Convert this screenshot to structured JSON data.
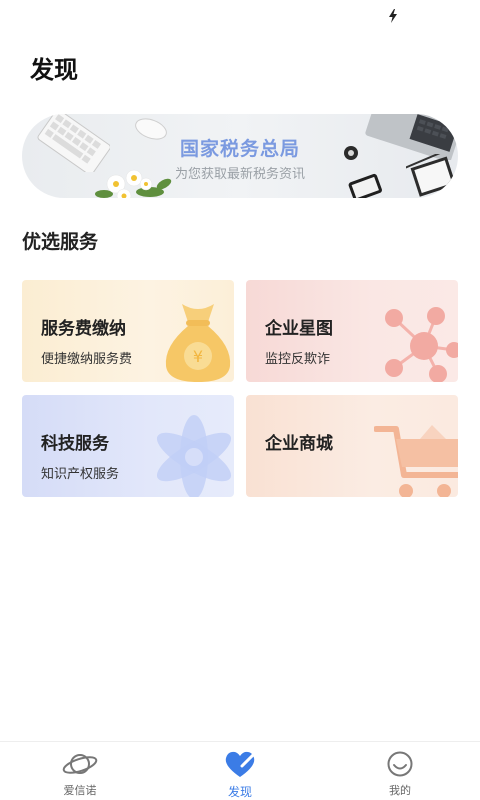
{
  "page": {
    "title": "发现"
  },
  "banner": {
    "title": "国家税务总局",
    "subtitle": "为您获取最新税务资讯"
  },
  "section": {
    "title": "优选服务"
  },
  "services": [
    {
      "title": "服务费缴纳",
      "subtitle": "便捷缴纳服务费",
      "icon": "money-bag-icon",
      "accent": "#f5c86a"
    },
    {
      "title": "企业星图",
      "subtitle": "监控反欺诈",
      "icon": "network-graph-icon",
      "accent": "#f2a6a0"
    },
    {
      "title": "科技服务",
      "subtitle": "知识产权服务",
      "icon": "atom-icon",
      "accent": "#b7c6f4"
    },
    {
      "title": "企业商城",
      "subtitle": "",
      "icon": "shopping-cart-icon",
      "accent": "#f3b99a"
    }
  ],
  "tabbar": {
    "items": [
      {
        "label": "爱信诺",
        "icon": "planet-icon",
        "active": false
      },
      {
        "label": "发现",
        "icon": "heart-check-icon",
        "active": true
      },
      {
        "label": "我的",
        "icon": "smiley-icon",
        "active": false
      }
    ],
    "active_color": "#3b7ce6",
    "inactive_color": "#666666"
  }
}
